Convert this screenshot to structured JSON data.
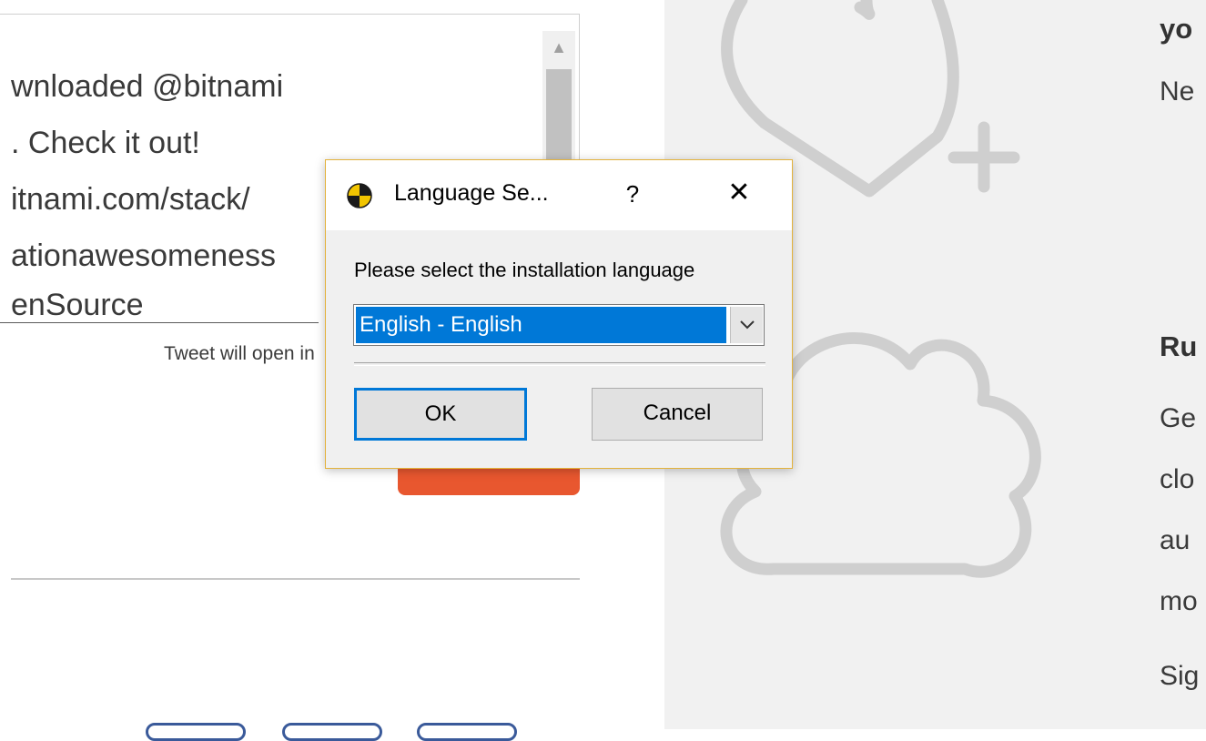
{
  "tweet": {
    "lines": [
      "wnloaded @bitnami",
      ". Check it out!",
      "itnami.com/stack/",
      "ationawesomeness",
      "enSource"
    ],
    "note": "Tweet will open in a new window"
  },
  "right_panel": {
    "lines": [
      {
        "text": "yo",
        "bold": true
      },
      {
        "text": "Ne",
        "bold": false
      },
      {
        "text": "Ru",
        "bold": true
      },
      {
        "text": "Ge",
        "bold": false
      },
      {
        "text": "clo",
        "bold": false
      },
      {
        "text": "au",
        "bold": false
      },
      {
        "text": "mo",
        "bold": false
      },
      {
        "text": "Sig",
        "bold": false
      }
    ]
  },
  "dialog": {
    "title": "Language Se...",
    "help_label": "?",
    "close_label": "✕",
    "prompt": "Please select the installation language",
    "selected_language": "English - English",
    "ok_label": "OK",
    "cancel_label": "Cancel"
  },
  "colors": {
    "accent_orange": "#e8572f",
    "select_highlight": "#0078d7",
    "dialog_border": "#e3b23c"
  }
}
